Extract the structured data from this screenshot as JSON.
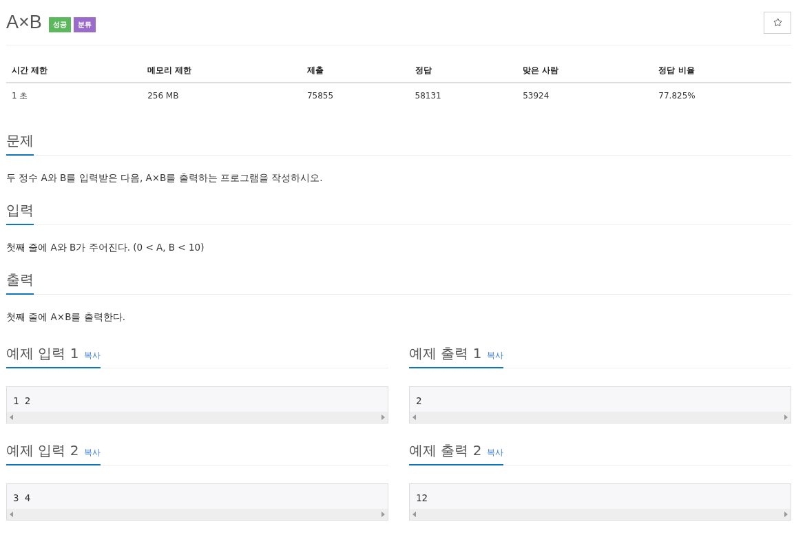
{
  "title": "A×B",
  "badges": [
    {
      "label": "성공",
      "color": "#5cb85c"
    },
    {
      "label": "분류",
      "color": "#9b6bcc"
    }
  ],
  "info_table": {
    "columns": [
      "시간 제한",
      "메모리 제한",
      "제출",
      "정답",
      "맞은 사람",
      "정답 비율"
    ],
    "rows": [
      [
        "1 초",
        "256 MB",
        "75855",
        "58131",
        "53924",
        "77.825%"
      ]
    ]
  },
  "sections": [
    {
      "heading": "문제",
      "text": "두 정수 A와 B를 입력받은 다음, A×B를 출력하는 프로그램을 작성하시오."
    },
    {
      "heading": "입력",
      "text": "첫째 줄에 A와 B가 주어진다. (0 < A, B < 10)"
    },
    {
      "heading": "출력",
      "text": "첫째 줄에 A×B를 출력한다."
    }
  ],
  "samples": [
    {
      "heading": "예제 입력 1",
      "copy": "복사",
      "content": "1 2"
    },
    {
      "heading": "예제 출력 1",
      "copy": "복사",
      "content": "2"
    },
    {
      "heading": "예제 입력 2",
      "copy": "복사",
      "content": "3 4"
    },
    {
      "heading": "예제 출력 2",
      "copy": "복사",
      "content": "12"
    }
  ]
}
